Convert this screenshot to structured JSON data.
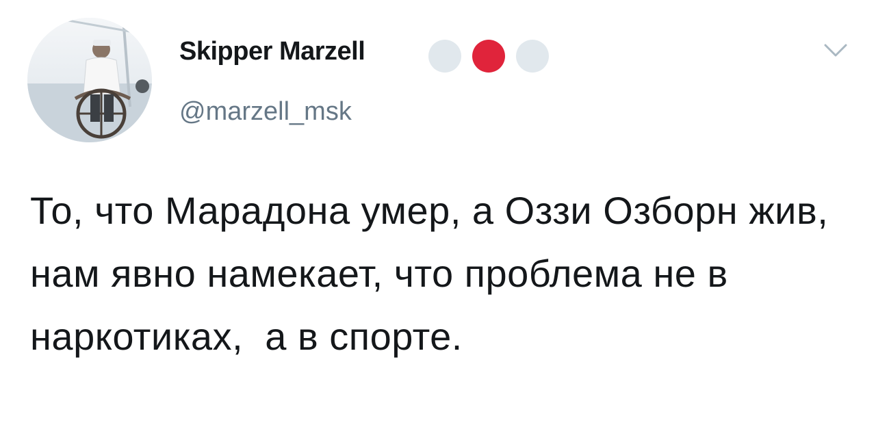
{
  "author": {
    "display_name": "Skipper Marzell",
    "handle": "@marzell_msk",
    "avatar_icon": "user-avatar-photo"
  },
  "badges": [
    {
      "name": "white-circle",
      "color": "#e1e8ed"
    },
    {
      "name": "red-circle",
      "color": "#e0243b"
    },
    {
      "name": "white-circle",
      "color": "#e1e8ed"
    }
  ],
  "menu_icon": "chevron-down-icon",
  "tweet": {
    "text": "То, что Марадона умер, а Оззи Озборн жив, нам явно намекает, что проблема не в наркотиках,  а в спорте."
  },
  "colors": {
    "text": "#14171a",
    "secondary": "#657786",
    "caret": "#aab8c2"
  }
}
